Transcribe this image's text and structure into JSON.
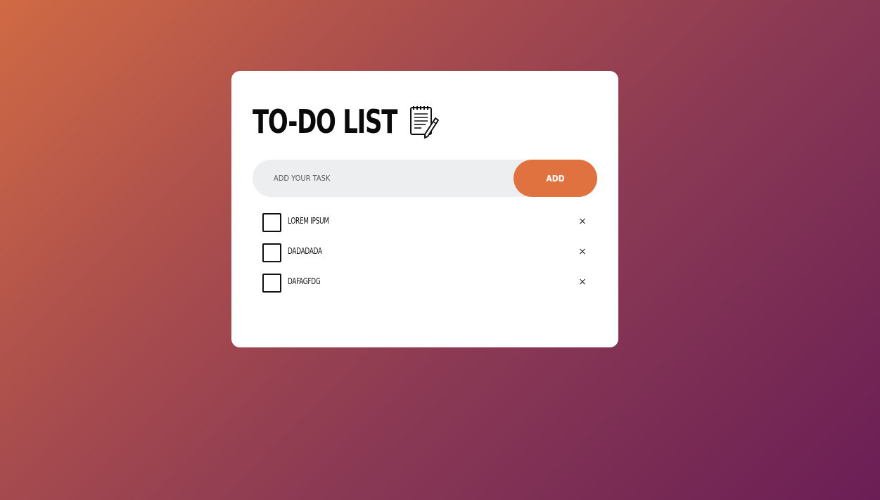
{
  "app": {
    "title": "TO-DO LIST",
    "title_icon": "notepad-pencil-icon"
  },
  "input": {
    "value": "",
    "placeholder": "ADD YOUR TASK"
  },
  "add_button": {
    "label": "ADD"
  },
  "tasks": [
    {
      "label": "LOREM IPSUM",
      "checked": false,
      "delete_icon": "close-icon",
      "delete_glyph": "×"
    },
    {
      "label": "DADADADA",
      "checked": false,
      "delete_icon": "close-icon",
      "delete_glyph": "×"
    },
    {
      "label": "DAFAGFDG",
      "checked": false,
      "delete_icon": "close-icon",
      "delete_glyph": "×"
    }
  ],
  "colors": {
    "accent": "#e07240",
    "card": "#ffffff",
    "input_bg": "#edeef0",
    "gradient_start": "#d06a44",
    "gradient_end": "#6a1e55"
  }
}
